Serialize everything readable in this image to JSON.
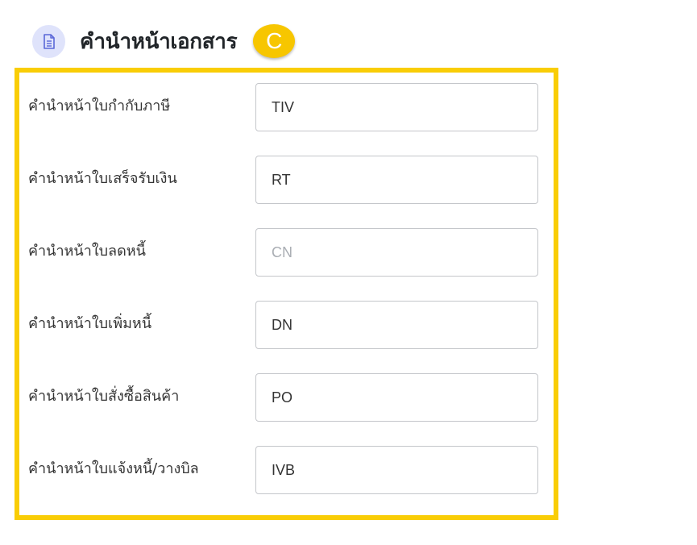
{
  "header": {
    "title": "คำนำหน้าเอกสาร",
    "icon": "document-icon",
    "badge": "C",
    "colors": {
      "accent_yellow": "#f9cd06",
      "icon_bg": "#dfe3fb",
      "icon_fg": "#5a67d8"
    }
  },
  "fields": [
    {
      "label": "คำนำหน้าใบกำกับภาษี",
      "value": "TIV",
      "placeholder": ""
    },
    {
      "label": "คำนำหน้าใบเสร็จรับเงิน",
      "value": "RT",
      "placeholder": ""
    },
    {
      "label": "คำนำหน้าใบลดหนี้",
      "value": "",
      "placeholder": "CN"
    },
    {
      "label": "คำนำหน้าใบเพิ่มหนี้",
      "value": "DN",
      "placeholder": ""
    },
    {
      "label": "คำนำหน้าใบสั่งซื้อสินค้า",
      "value": "PO",
      "placeholder": ""
    },
    {
      "label": "คำนำหน้าใบแจ้งหนี้/วางบิล",
      "value": "IVB",
      "placeholder": ""
    }
  ]
}
